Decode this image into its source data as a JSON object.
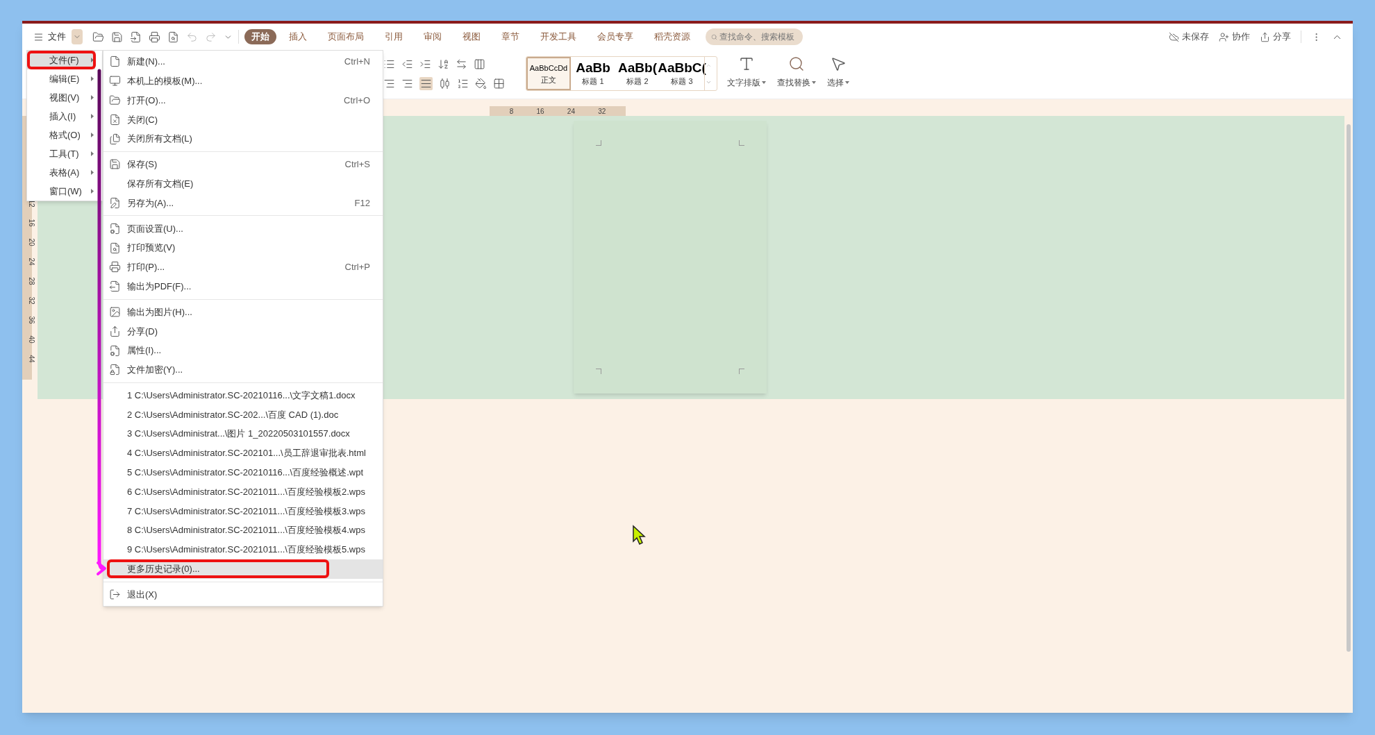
{
  "top_bar": {
    "menu_label": "文件",
    "tabs": [
      {
        "label": "开始",
        "selected": true
      },
      {
        "label": "插入",
        "selected": false
      },
      {
        "label": "页面布局",
        "selected": false
      },
      {
        "label": "引用",
        "selected": false
      },
      {
        "label": "审阅",
        "selected": false
      },
      {
        "label": "视图",
        "selected": false
      },
      {
        "label": "章节",
        "selected": false
      },
      {
        "label": "开发工具",
        "selected": false
      },
      {
        "label": "会员专享",
        "selected": false
      },
      {
        "label": "稻壳资源",
        "selected": false
      }
    ],
    "search": {
      "placeholder": "查找命令、搜索模板"
    },
    "actions": [
      {
        "label": "未保存",
        "kind": "cloud"
      },
      {
        "label": "协作",
        "kind": "user"
      },
      {
        "label": "分享",
        "kind": "share"
      }
    ]
  },
  "ribbon": {
    "styles": [
      {
        "preview": "AaBbCcDd",
        "label": "正文",
        "selected": true,
        "kind": "body"
      },
      {
        "preview": "AaBb",
        "label": "标题 1",
        "selected": false,
        "kind": "heading"
      },
      {
        "preview": "AaBb(",
        "label": "标题 2",
        "selected": false,
        "kind": "heading"
      },
      {
        "preview": "AaBbC(",
        "label": "标题 3",
        "selected": false,
        "kind": "heading"
      }
    ],
    "tools": [
      {
        "label": "文字排版",
        "kind": "layout"
      },
      {
        "label": "查找替换",
        "kind": "find"
      },
      {
        "label": "选择",
        "kind": "select"
      }
    ]
  },
  "ruler": {
    "h_ticks": [
      "8",
      "16",
      "24",
      "32"
    ],
    "v_ticks": [
      "12",
      "16",
      "20",
      "24",
      "28",
      "32",
      "36",
      "40",
      "44"
    ]
  },
  "menu_bar_menu": {
    "items": [
      {
        "label": "文件(F)",
        "selected": true
      },
      {
        "label": "编辑(E)",
        "selected": false
      },
      {
        "label": "视图(V)",
        "selected": false
      },
      {
        "label": "插入(I)",
        "selected": false
      },
      {
        "label": "格式(O)",
        "selected": false
      },
      {
        "label": "工具(T)",
        "selected": false
      },
      {
        "label": "表格(A)",
        "selected": false
      },
      {
        "label": "窗口(W)",
        "selected": false
      }
    ]
  },
  "file_menu": {
    "sections": [
      [
        {
          "label": "新建(N)...",
          "shortcut": "Ctrl+N",
          "kind": "new",
          "selected": false
        },
        {
          "label": "本机上的模板(M)...",
          "kind": "template",
          "selected": false
        },
        {
          "label": "打开(O)...",
          "shortcut": "Ctrl+O",
          "kind": "open",
          "selected": false
        },
        {
          "label": "关闭(C)",
          "kind": "close",
          "selected": false
        },
        {
          "label": "关闭所有文档(L)",
          "kind": "close_all",
          "selected": false
        }
      ],
      [
        {
          "label": "保存(S)",
          "shortcut": "Ctrl+S",
          "kind": "save",
          "selected": false
        },
        {
          "label": "保存所有文档(E)",
          "kind": "save_all",
          "selected": false
        },
        {
          "label": "另存为(A)...",
          "shortcut": "F12",
          "kind": "save_as",
          "selected": false
        }
      ],
      [
        {
          "label": "页面设置(U)...",
          "kind": "page_setup",
          "selected": false
        },
        {
          "label": "打印预览(V)",
          "kind": "print_preview",
          "selected": false
        },
        {
          "label": "打印(P)...",
          "shortcut": "Ctrl+P",
          "kind": "print",
          "selected": false
        },
        {
          "label": "输出为PDF(F)...",
          "kind": "pdf",
          "selected": false
        }
      ],
      [
        {
          "label": "输出为图片(H)...",
          "kind": "image",
          "selected": false
        },
        {
          "label": "分享(D)",
          "kind": "share",
          "selected": false
        },
        {
          "label": "属性(I)...",
          "kind": "properties",
          "selected": false
        },
        {
          "label": "文件加密(Y)...",
          "kind": "encrypt",
          "selected": false
        }
      ],
      [
        {
          "label": "1 C:\\Users\\Administrator.SC-20210116...\\文字文稿1.docx",
          "kind": "recent",
          "selected": false
        },
        {
          "label": "2 C:\\Users\\Administrator.SC-202...\\百度 CAD  (1).doc",
          "kind": "recent",
          "selected": false
        },
        {
          "label": "3 C:\\Users\\Administrat...\\图片 1_20220503101557.docx",
          "kind": "recent",
          "selected": false
        },
        {
          "label": "4 C:\\Users\\Administrator.SC-202101...\\员工辞退审批表.html",
          "kind": "recent",
          "selected": false
        },
        {
          "label": "5 C:\\Users\\Administrator.SC-20210116...\\百度经验概述.wpt",
          "kind": "recent",
          "selected": false
        },
        {
          "label": "6 C:\\Users\\Administrator.SC-2021011...\\百度经验模板2.wps",
          "kind": "recent",
          "selected": false
        },
        {
          "label": "7 C:\\Users\\Administrator.SC-2021011...\\百度经验模板3.wps",
          "kind": "recent",
          "selected": false
        },
        {
          "label": "8 C:\\Users\\Administrator.SC-2021011...\\百度经验模板4.wps",
          "kind": "recent",
          "selected": false
        },
        {
          "label": "9 C:\\Users\\Administrator.SC-2021011...\\百度经验模板5.wps",
          "kind": "recent",
          "selected": false
        },
        {
          "label": "更多历史记录(0)...",
          "kind": "more",
          "selected": true
        }
      ],
      [
        {
          "label": "退出(X)",
          "kind": "exit",
          "selected": false
        }
      ]
    ]
  }
}
